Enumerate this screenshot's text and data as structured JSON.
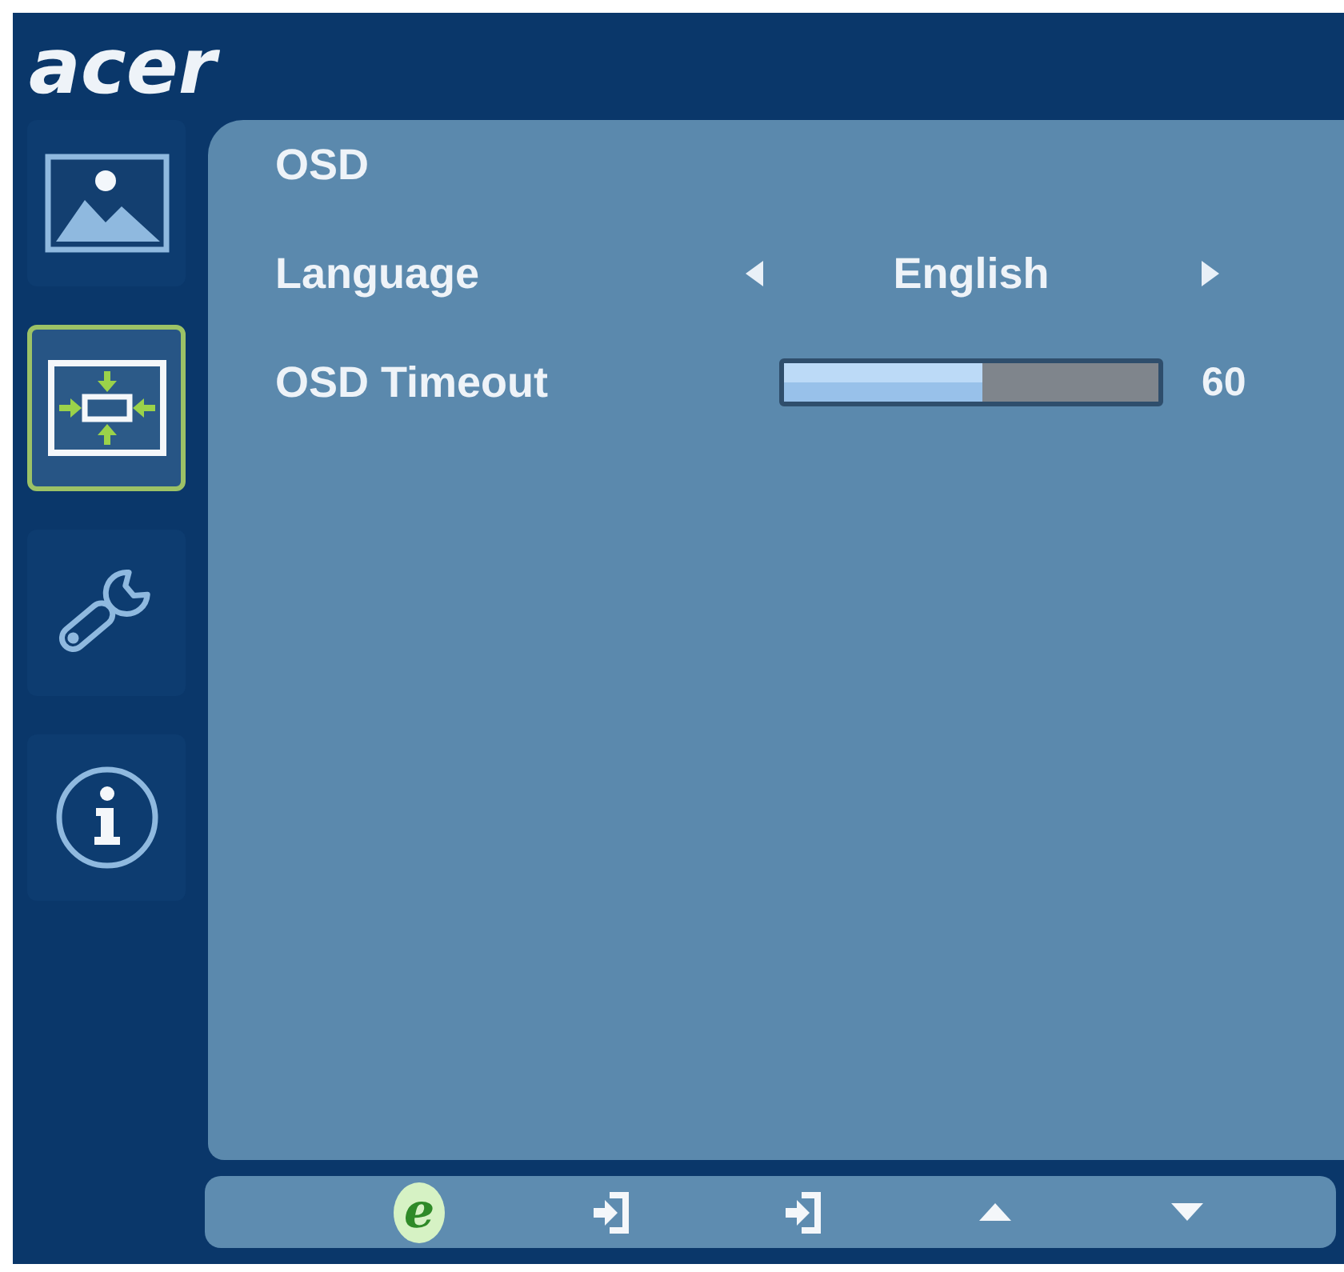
{
  "logo": "acer",
  "sidebar": {
    "items": [
      {
        "kind": "picture",
        "selected": false
      },
      {
        "kind": "display",
        "selected": true
      },
      {
        "kind": "settings",
        "selected": false
      },
      {
        "kind": "info",
        "selected": false
      }
    ]
  },
  "panel": {
    "title": "OSD",
    "rows": [
      {
        "kind": "choice",
        "label": "Language",
        "value": "English"
      },
      {
        "kind": "slider",
        "label": "OSD Timeout",
        "level": 0.53,
        "reading": "60"
      }
    ]
  },
  "button_bar": {
    "buttons": [
      {
        "kind": "text",
        "label": "e"
      },
      {
        "kind": "enter"
      },
      {
        "kind": "enter"
      },
      {
        "kind": "up"
      },
      {
        "kind": "down"
      }
    ]
  }
}
